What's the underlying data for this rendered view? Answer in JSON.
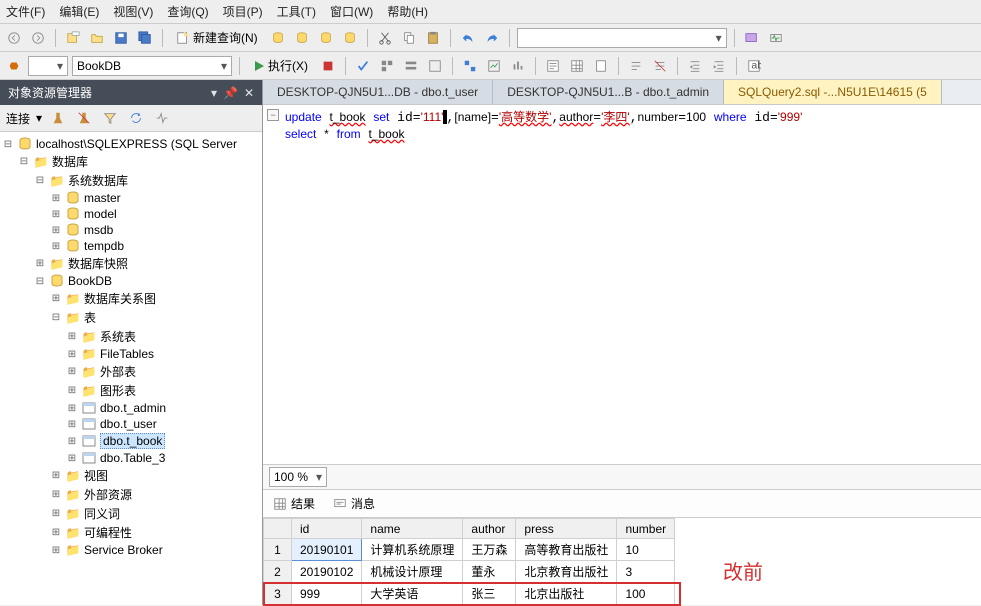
{
  "menu": {
    "file": "文件(F)",
    "edit": "编辑(E)",
    "view": "视图(V)",
    "query": "查询(Q)",
    "project": "项目(P)",
    "tool": "工具(T)",
    "window": "窗口(W)",
    "help": "帮助(H)"
  },
  "toolbar1": {
    "newquery": "新建查询(N)"
  },
  "toolbar2": {
    "db": "BookDB",
    "execute": "执行(X)"
  },
  "panel": {
    "title": "对象资源管理器",
    "connect": "连接"
  },
  "tree": {
    "server": "localhost\\SQLEXPRESS (SQL Server",
    "databases": "数据库",
    "sysdb": "系统数据库",
    "master": "master",
    "model": "model",
    "msdb": "msdb",
    "tempdb": "tempdb",
    "snapshot": "数据库快照",
    "bookdb": "BookDB",
    "diagram": "数据库关系图",
    "tables": "表",
    "systables": "系统表",
    "filetables": "FileTables",
    "exttables": "外部表",
    "graphtables": "图形表",
    "t_admin": "dbo.t_admin",
    "t_user": "dbo.t_user",
    "t_book": "dbo.t_book",
    "table3": "dbo.Table_3",
    "views": "视图",
    "extres": "外部资源",
    "synonyms": "同义词",
    "programmability": "可编程性",
    "svcbroker": "Service Broker"
  },
  "tabs": {
    "t1": "DESKTOP-QJN5U1...DB - dbo.t_user",
    "t2": "DESKTOP-QJN5U1...B - dbo.t_admin",
    "t3": "SQLQuery2.sql -...N5U1E\\14615 (5"
  },
  "sql": {
    "update_kw": "update",
    "tbook": "t_book",
    "set_kw": "set",
    "idv1": "'111'",
    "name_lbl": "[name]",
    "name_v": "'高等数学'",
    "auth_lbl": "author",
    "auth_v": "'李四'",
    "num_lbl": "number",
    "num_v": "100",
    "where_kw": "where",
    "idv2": "'999'",
    "select_kw": "select",
    "from_kw": "from",
    "star": "*"
  },
  "zoom": "100 %",
  "restabs": {
    "results": "结果",
    "messages": "消息"
  },
  "grid": {
    "headers": [
      "id",
      "name",
      "author",
      "press",
      "number"
    ],
    "rows": [
      {
        "n": "1",
        "id": "20190101",
        "name": "计算机系统原理",
        "author": "王万森",
        "press": "高等教育出版社",
        "number": "10"
      },
      {
        "n": "2",
        "id": "20190102",
        "name": "机械设计原理",
        "author": "董永",
        "press": "北京教育出版社",
        "number": "3"
      },
      {
        "n": "3",
        "id": "999",
        "name": "大学英语",
        "author": "张三",
        "press": "北京出版社",
        "number": "100"
      }
    ]
  },
  "annotation": "改前",
  "chart_data": {
    "type": "table",
    "title": "t_book query result",
    "columns": [
      "id",
      "name",
      "author",
      "press",
      "number"
    ],
    "rows": [
      [
        "20190101",
        "计算机系统原理",
        "王万森",
        "高等教育出版社",
        10
      ],
      [
        "20190102",
        "机械设计原理",
        "董永",
        "北京教育出版社",
        3
      ],
      [
        "999",
        "大学英语",
        "张三",
        "北京出版社",
        100
      ]
    ]
  }
}
